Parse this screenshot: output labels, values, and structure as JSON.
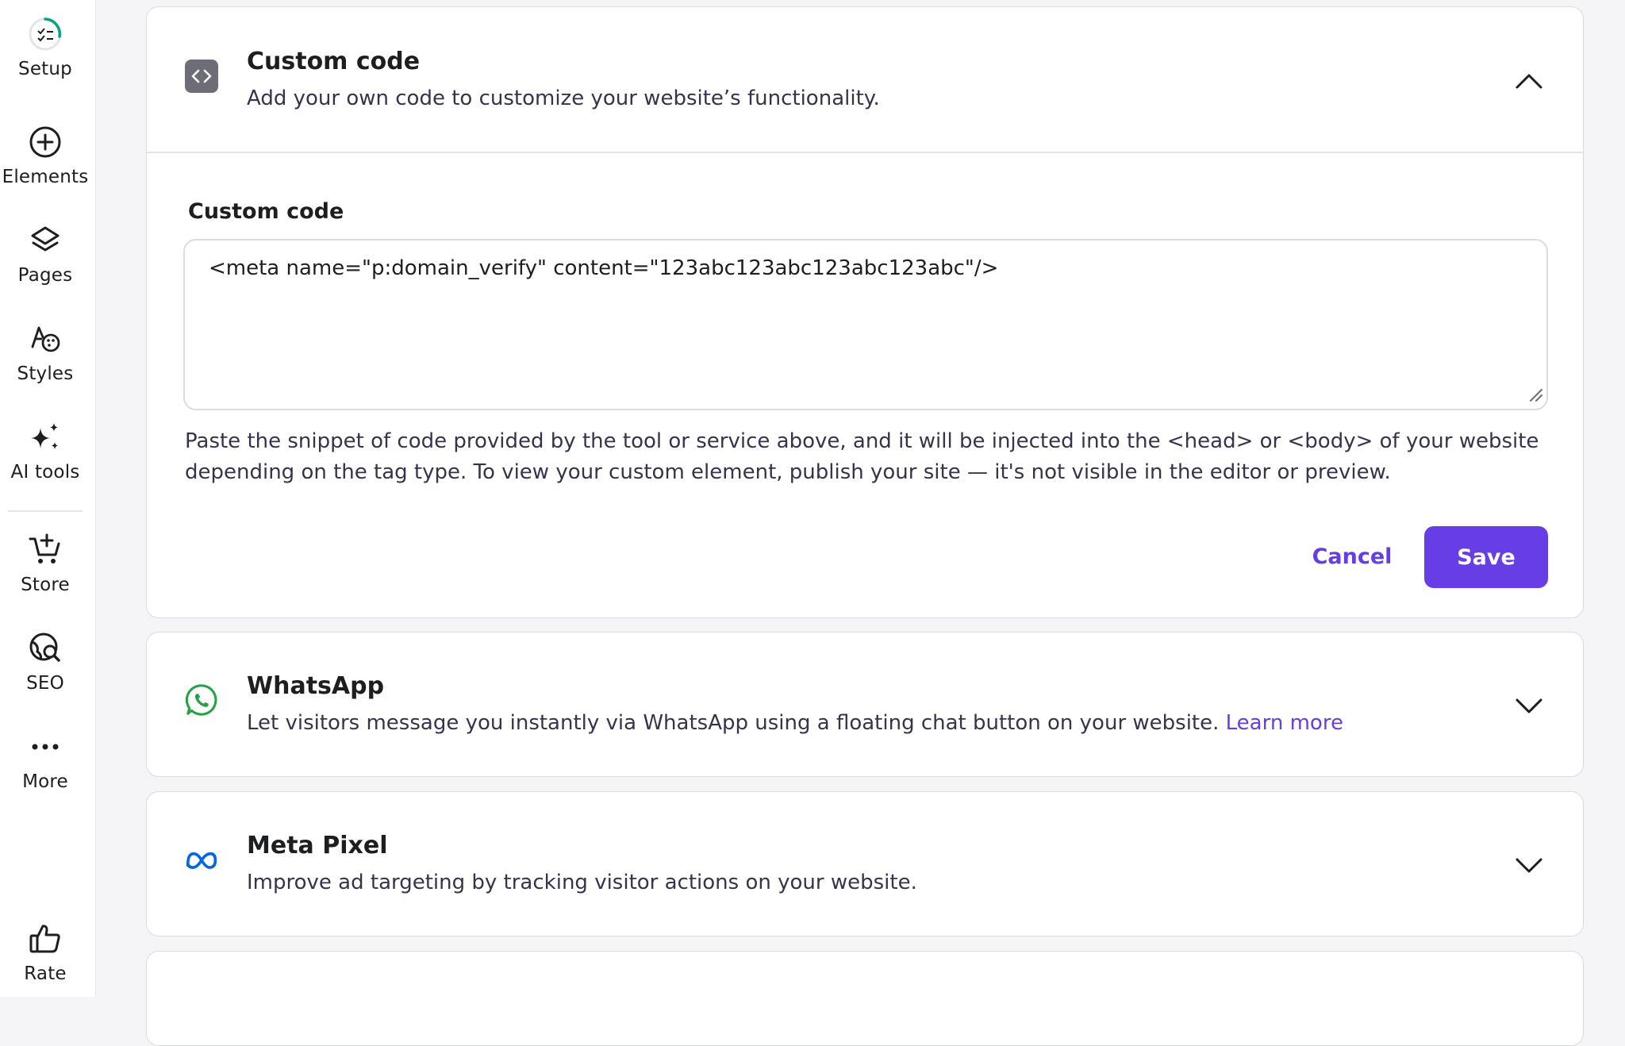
{
  "sidebar": {
    "items": [
      {
        "label": "Setup",
        "icon": "setup-progress-icon"
      },
      {
        "label": "Elements",
        "icon": "plus-circle-icon"
      },
      {
        "label": "Pages",
        "icon": "layers-icon"
      },
      {
        "label": "Styles",
        "icon": "palette-icon"
      },
      {
        "label": "AI tools",
        "icon": "sparkles-icon"
      },
      {
        "label": "Store",
        "icon": "cart-icon"
      },
      {
        "label": "SEO",
        "icon": "globe-search-icon"
      },
      {
        "label": "More",
        "icon": "more-dots-icon"
      },
      {
        "label": "Rate",
        "icon": "thumbs-up-icon"
      }
    ]
  },
  "custom_code": {
    "title": "Custom code",
    "description": "Add your own code to customize your website’s functionality.",
    "field_label": "Custom code",
    "value": "<meta name=\"p:domain_verify\" content=\"123abc123abc123abc123abc\"/>",
    "help": "Paste the snippet of code provided by the tool or service above, and it will be injected into the <head> or <body> of your website depending on the tag type. To view your custom element, publish your site — it's not visible in the editor or preview.",
    "cancel_label": "Cancel",
    "save_label": "Save"
  },
  "whatsapp": {
    "title": "WhatsApp",
    "description": "Let visitors message you instantly via WhatsApp using a floating chat button on your website.",
    "link": "Learn more"
  },
  "meta_pixel": {
    "title": "Meta Pixel",
    "description": "Improve ad targeting by tracking visitor actions on your website."
  },
  "colors": {
    "accent": "#673de6",
    "whatsapp_green": "#25a244",
    "meta_blue": "#0668e1",
    "setup_progress": "#00b090"
  }
}
